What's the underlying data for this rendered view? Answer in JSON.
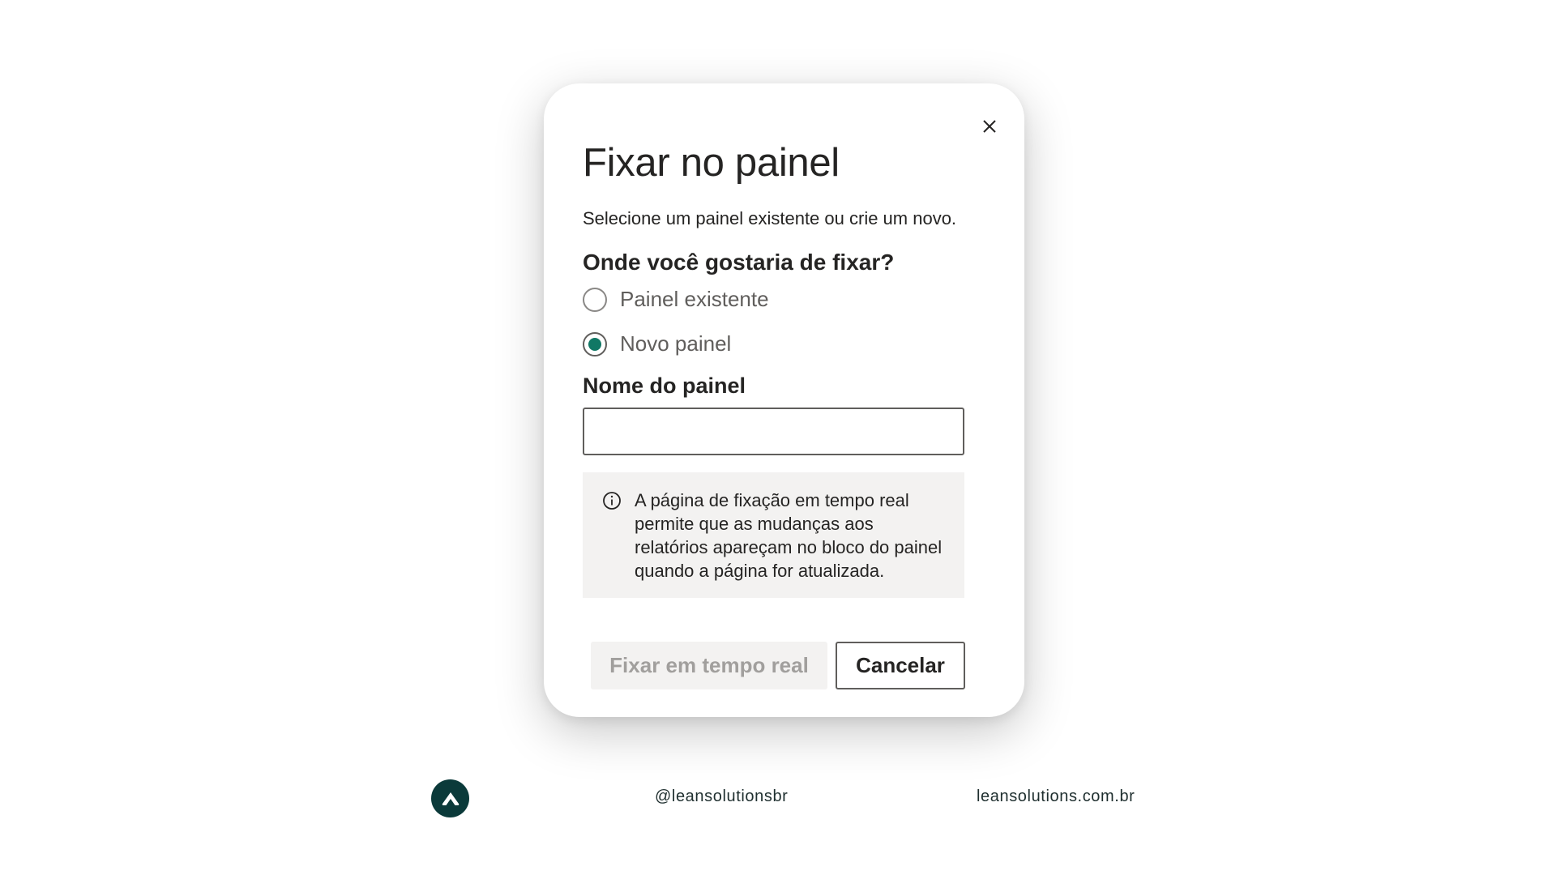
{
  "dialog": {
    "title": "Fixar no painel",
    "subtitle": "Selecione um painel existente ou crie um novo.",
    "question": "Onde você gostaria de fixar?",
    "options": [
      {
        "label": "Painel existente",
        "selected": false
      },
      {
        "label": "Novo painel",
        "selected": true
      }
    ],
    "name_field": {
      "label": "Nome do painel",
      "value": "",
      "placeholder": ""
    },
    "info_text": "A página de fixação em tempo real permite que as mudanças aos relatórios apareçam no bloco do painel quando a página for atualizada.",
    "primary_button": "Fixar em tempo real",
    "cancel_button": "Cancelar",
    "close_icon": "close-icon",
    "info_icon": "info-icon"
  },
  "footer": {
    "logo_icon": "chevron-up-icon",
    "handle": "@leansolutionsbr",
    "site": "leansolutions.com.br"
  },
  "colors": {
    "accent": "#117865",
    "logo_bg": "#0b3a3a",
    "disabled_text": "#a19f9d",
    "info_bg": "#f3f2f1"
  }
}
